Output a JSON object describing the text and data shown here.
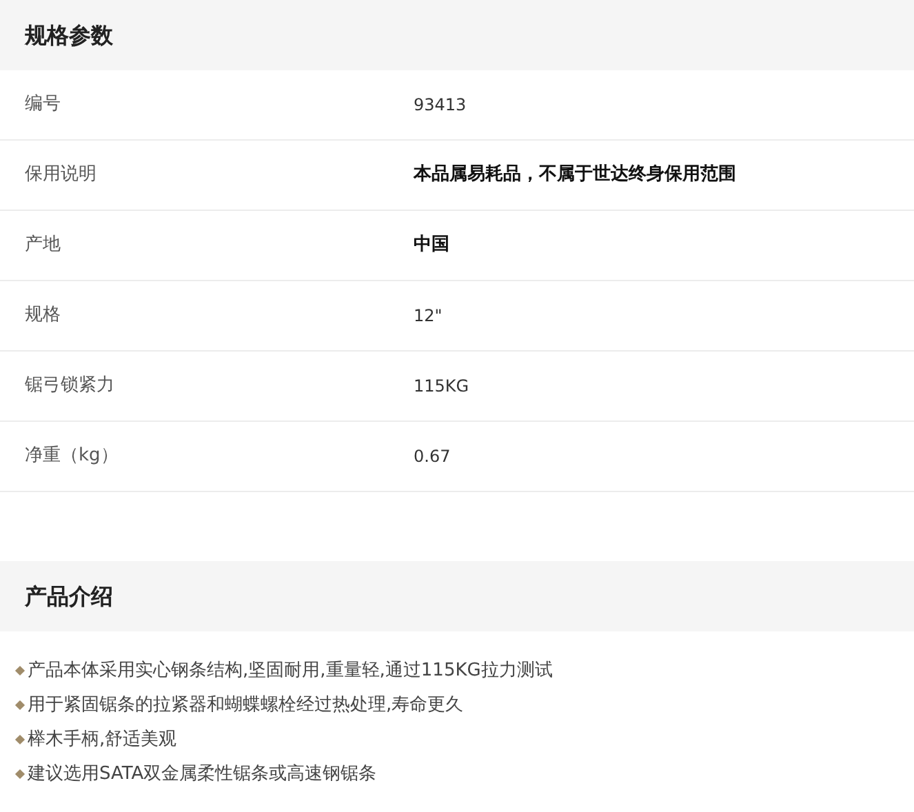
{
  "specs": {
    "title": "规格参数",
    "rows": [
      {
        "label": "编号",
        "value": "93413",
        "bold": false
      },
      {
        "label": "保用说明",
        "value": "本品属易耗品，不属于世达终身保用范围",
        "bold": true
      },
      {
        "label": "产地",
        "value": "中国",
        "bold": true
      },
      {
        "label": "规格",
        "value": "12\"",
        "bold": false
      },
      {
        "label": "锯弓锁紧力",
        "value": "115KG",
        "bold": false
      },
      {
        "label": "净重（kg）",
        "value": "0.67",
        "bold": false
      }
    ]
  },
  "intro": {
    "title": "产品介绍",
    "bullets": [
      "产品本体采用实心钢条结构,坚固耐用,重量轻,通过115KG拉力测试",
      "用于紧固锯条的拉紧器和蝴蝶螺栓经过热处理,寿命更久",
      "榉木手柄,舒适美观",
      "建议选用SATA双金属柔性锯条或高速钢锯条"
    ]
  }
}
